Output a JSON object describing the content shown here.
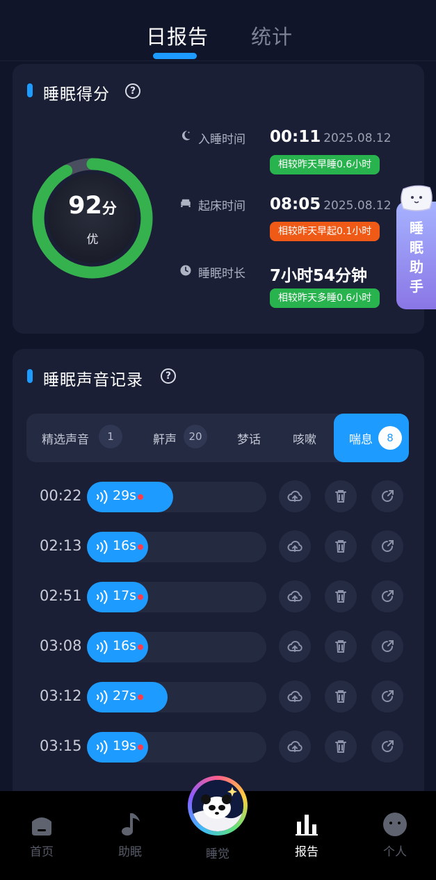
{
  "top_tabs": {
    "daily": "日报告",
    "stats": "统计"
  },
  "score_card": {
    "title": "睡眠得分",
    "score": "92",
    "score_unit": "分",
    "grade": "优",
    "score_fraction": 0.92,
    "ring_color": "#35b24e",
    "metrics": [
      {
        "label": "入睡时间",
        "icon": "moon-icon",
        "value": "00:11",
        "date": "2025.08.12",
        "compare": "相较昨天早睡0.6小时",
        "compare_color": "#29b34f"
      },
      {
        "label": "起床时间",
        "icon": "bed-icon",
        "value": "08:05",
        "date": "2025.08.12",
        "compare": "相较昨天早起0.1小时",
        "compare_color": "#f05a17"
      },
      {
        "label": "睡眠时长",
        "icon": "clock-icon",
        "value": "7小时54分钟",
        "date": "",
        "compare": "相较昨天多睡0.6小时",
        "compare_color": "#29b34f"
      }
    ]
  },
  "assistant": {
    "label": "睡眠助手"
  },
  "sound_card": {
    "title": "睡眠声音记录",
    "categories": [
      {
        "label": "精选声音",
        "count": "1"
      },
      {
        "label": "鼾声",
        "count": "20"
      },
      {
        "label": "梦话",
        "count": ""
      },
      {
        "label": "咳嗽",
        "count": ""
      },
      {
        "label": "喘息",
        "count": "8",
        "active": true
      }
    ],
    "records": [
      {
        "time": "00:22",
        "length": "29s",
        "fill_fraction": 0.48
      },
      {
        "time": "02:13",
        "length": "16s",
        "fill_fraction": 0.34
      },
      {
        "time": "02:51",
        "length": "17s",
        "fill_fraction": 0.34
      },
      {
        "time": "03:08",
        "length": "16s",
        "fill_fraction": 0.34
      },
      {
        "time": "03:12",
        "length": "27s",
        "fill_fraction": 0.45
      },
      {
        "time": "03:15",
        "length": "19s",
        "fill_fraction": 0.34
      }
    ]
  },
  "bottom_nav": [
    {
      "label": "首页",
      "icon": "home-icon"
    },
    {
      "label": "助眠",
      "icon": "music-note-icon"
    },
    {
      "label": "睡觉",
      "icon": "panda-sleep-icon"
    },
    {
      "label": "报告",
      "icon": "bar-chart-icon",
      "active": true
    },
    {
      "label": "个人",
      "icon": "profile-icon"
    }
  ],
  "colors": {
    "accent": "#1e9bff",
    "background": "#10152a",
    "card": "#1a1f35",
    "alert_dot": "#ff3b4a"
  }
}
